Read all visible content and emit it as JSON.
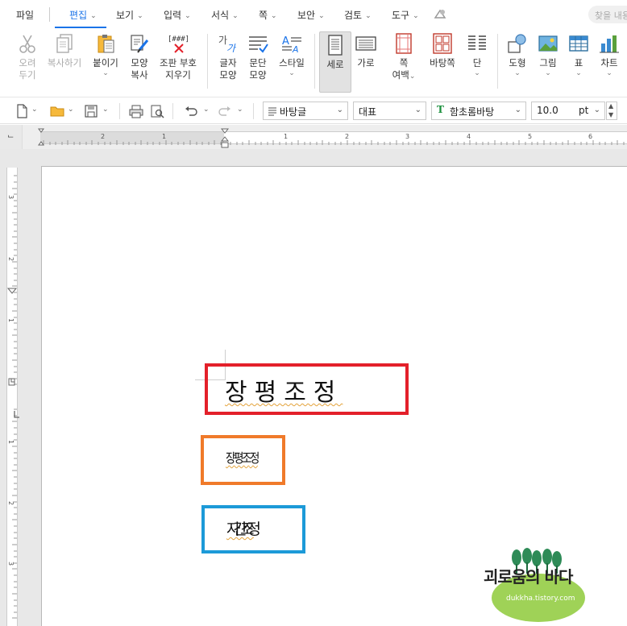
{
  "menubar": {
    "file": "파일",
    "items": [
      {
        "label": "편집",
        "active": true
      },
      {
        "label": "보기"
      },
      {
        "label": "입력"
      },
      {
        "label": "서식"
      },
      {
        "label": "쪽"
      },
      {
        "label": "보안"
      },
      {
        "label": "검토"
      },
      {
        "label": "도구"
      }
    ],
    "search_placeholder": "찾을 내용"
  },
  "ribbon": {
    "cut": {
      "line1": "오려",
      "line2": "두기",
      "icon": "scissors-icon"
    },
    "copy": {
      "line1": "복사하기",
      "icon": "copy-icon"
    },
    "paste": {
      "line1": "붙이기",
      "icon": "paste-icon"
    },
    "format_copy": {
      "line1": "모양",
      "line2": "복사",
      "icon": "format-painter-icon"
    },
    "clear_marks": {
      "line1": "조판 부호",
      "line2": "지우기",
      "icon": "clear-marks-icon"
    },
    "char_shape": {
      "line1": "글자",
      "line2": "모양",
      "icon": "char-shape-icon"
    },
    "para_shape": {
      "line1": "문단",
      "line2": "모양",
      "icon": "para-shape-icon"
    },
    "style": {
      "line1": "스타일",
      "icon": "style-icon"
    },
    "portrait": {
      "line1": "세로",
      "icon": "portrait-icon"
    },
    "landscape": {
      "line1": "가로",
      "icon": "landscape-icon"
    },
    "page_margin": {
      "line1": "쪽",
      "line2": "여백",
      "icon": "page-margin-icon"
    },
    "background": {
      "line1": "바탕쪽",
      "icon": "background-page-icon"
    },
    "columns": {
      "line1": "단",
      "icon": "columns-icon"
    },
    "shape": {
      "line1": "도형",
      "icon": "shape-icon"
    },
    "picture": {
      "line1": "그림",
      "icon": "picture-icon"
    },
    "table": {
      "line1": "표",
      "icon": "table-icon"
    },
    "chart": {
      "line1": "차트",
      "icon": "chart-icon"
    }
  },
  "toolbar": {
    "style_combo": "바탕글",
    "lang_combo": "대표",
    "font_combo": "함초롬바탕",
    "font_size": "10.0",
    "font_unit": "pt"
  },
  "ruler": {
    "h_numbers": [
      "2",
      "1",
      "1",
      "2",
      "3",
      "4",
      "5",
      "6"
    ],
    "v_numbers": [
      "3",
      "2",
      "1",
      "1",
      "2",
      "3"
    ]
  },
  "document": {
    "text_wide": "장평조정",
    "text_narrow": "장평조정",
    "text_overlap": "자간조정"
  },
  "watermark": {
    "title": "괴로움의 바다",
    "url": "dukkha.tistory.com"
  },
  "colors": {
    "accent": "#1a73e8",
    "frame_red": "#e3202a",
    "frame_orange": "#f07a2a",
    "frame_blue": "#1c9ad8"
  }
}
